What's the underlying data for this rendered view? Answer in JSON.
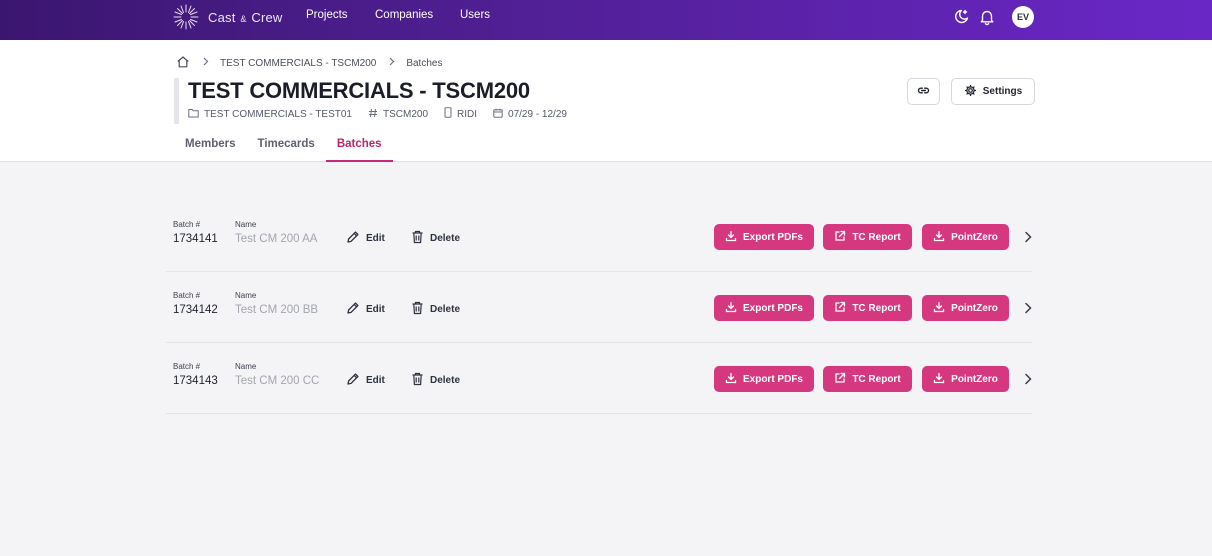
{
  "nav": {
    "brand_main": "Cast",
    "brand_amp": "&",
    "brand_tail": "Crew",
    "links": [
      "Projects",
      "Companies",
      "Users"
    ],
    "avatar_initials": "EV",
    "icons": [
      "logo-starburst-icon",
      "moon-star-icon",
      "bell-icon"
    ]
  },
  "breadcrumb": {
    "home_icon": "home-icon",
    "items": [
      "TEST COMMERCIALS - TSCM200",
      "Batches"
    ]
  },
  "project": {
    "title": "TEST COMMERCIALS - TSCM200",
    "meta": {
      "folder": "TEST COMMERCIALS - TEST01",
      "code": "TSCM200",
      "device": "RIDI",
      "dates": "07/29 - 12/29"
    }
  },
  "header_actions": {
    "settings_label": "Settings",
    "link_icon": "link-icon",
    "settings_icon": "gear-icon"
  },
  "tabs": [
    {
      "label": "Members",
      "active": false
    },
    {
      "label": "Timecards",
      "active": false
    },
    {
      "label": "Batches",
      "active": true
    }
  ],
  "batches": {
    "batch_label": "Batch #",
    "name_label": "Name",
    "edit_label": "Edit",
    "delete_label": "Delete",
    "export_label": "Export PDFs",
    "tc_label": "TC Report",
    "pz_label": "PointZero",
    "rows": [
      {
        "number": "1734141",
        "name": "Test CM 200 AA"
      },
      {
        "number": "1734142",
        "name": "Test CM 200 BB"
      },
      {
        "number": "1734143",
        "name": "Test CM 200 CC"
      }
    ]
  },
  "colors": {
    "nav_gradient_start": "#3b1670",
    "nav_gradient_end": "#6a27c7",
    "accent": "#d6387f",
    "tab_active": "#b9266a"
  }
}
